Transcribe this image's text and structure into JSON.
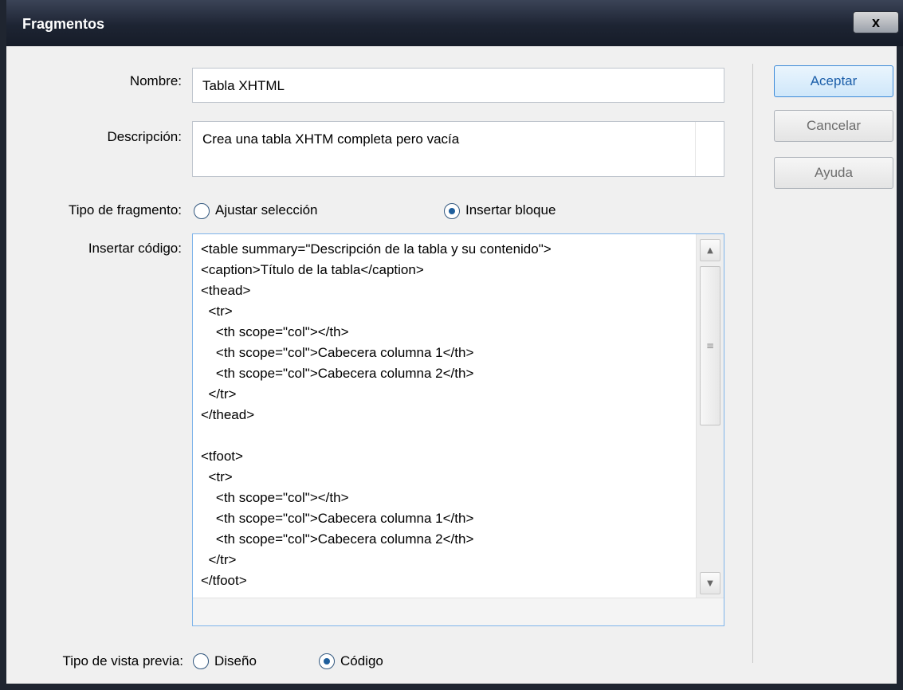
{
  "window": {
    "title": "Fragmentos",
    "close_label": "x"
  },
  "form": {
    "nombre_label": "Nombre:",
    "nombre_value": "Tabla XHTML",
    "descripcion_label": "Descripción:",
    "descripcion_value": "Crea una tabla XHTM completa pero vacía",
    "tipo_fragmento_label": "Tipo de fragmento:",
    "tipo_fragmento_options": [
      {
        "label": "Ajustar selección",
        "selected": false
      },
      {
        "label": "Insertar bloque",
        "selected": true
      }
    ],
    "insertar_codigo_label": "Insertar código:",
    "code_lines": [
      "<table summary=\"Descripción de la tabla y su contenido\">",
      "<caption>Título de la tabla</caption>",
      "<thead>",
      "  <tr>",
      "    <th scope=\"col\"></th>",
      "    <th scope=\"col\">Cabecera columna 1</th>",
      "    <th scope=\"col\">Cabecera columna 2</th>",
      "  </tr>",
      "</thead>",
      "",
      "<tfoot>",
      "  <tr>",
      "    <th scope=\"col\"></th>",
      "    <th scope=\"col\">Cabecera columna 1</th>",
      "    <th scope=\"col\">Cabecera columna 2</th>",
      "  </tr>",
      "</tfoot>"
    ],
    "vista_previa_label": "Tipo de vista previa:",
    "vista_previa_options": [
      {
        "label": "Diseño",
        "selected": false
      },
      {
        "label": "Código",
        "selected": true
      }
    ]
  },
  "buttons": {
    "aceptar": "Aceptar",
    "cancelar": "Cancelar",
    "ayuda": "Ayuda"
  },
  "colors": {
    "titlebar": "#1d2433",
    "accent_border": "#3c8ad8",
    "primary_text": "#1b5ea9"
  }
}
